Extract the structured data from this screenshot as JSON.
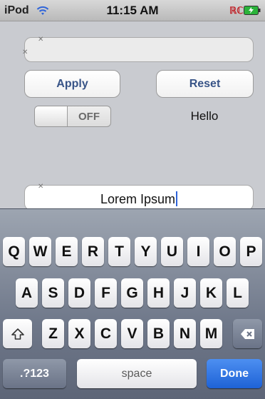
{
  "status": {
    "carrier": "iPod",
    "time": "11:15 AM",
    "app_badge": "ℝℂ"
  },
  "form": {
    "apply_label": "Apply",
    "reset_label": "Reset",
    "switch_label": "OFF",
    "hello_label": "Hello",
    "bottom_field_value": "Lorem Ipsum"
  },
  "keyboard": {
    "row1": [
      "Q",
      "W",
      "E",
      "R",
      "T",
      "Y",
      "U",
      "I",
      "O",
      "P"
    ],
    "row2": [
      "A",
      "S",
      "D",
      "F",
      "G",
      "H",
      "J",
      "K",
      "L"
    ],
    "row3": [
      "Z",
      "X",
      "C",
      "V",
      "B",
      "N",
      "M"
    ],
    "numbers_label": ".?123",
    "space_label": "space",
    "done_label": "Done"
  },
  "icons": {
    "wifi": "wifi-icon",
    "battery": "battery-icon",
    "shift": "shift-icon",
    "backspace": "backspace-icon",
    "clear": "clear-icon"
  },
  "colors": {
    "accent": "#2f64d9",
    "done_key": "#1e62d6",
    "button_text": "#385487"
  }
}
